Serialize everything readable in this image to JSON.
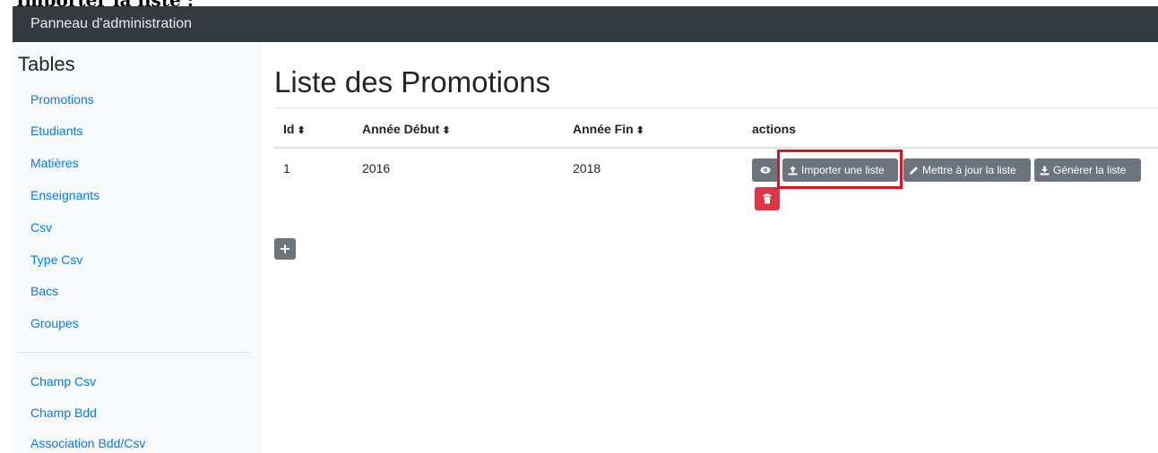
{
  "caption": "Importer la liste :",
  "navbar": {
    "brand": "Panneau d'administration"
  },
  "sidebar": {
    "heading": "Tables",
    "items": [
      {
        "label": "Promotions"
      },
      {
        "label": "Etudiants"
      },
      {
        "label": "Matières"
      },
      {
        "label": "Enseignants"
      },
      {
        "label": "Csv"
      },
      {
        "label": "Type Csv"
      },
      {
        "label": "Bacs"
      },
      {
        "label": "Groupes"
      }
    ],
    "items2": [
      {
        "label": "Champ Csv"
      },
      {
        "label": "Champ Bdd"
      },
      {
        "label": "Association Bdd/Csv"
      }
    ]
  },
  "main": {
    "title": "Liste des Promotions",
    "columns": [
      "Id",
      "Année Début",
      "Année Fin",
      "actions"
    ],
    "rows": [
      {
        "id": "1",
        "start": "2016",
        "end": "2018"
      }
    ],
    "actions": {
      "view_icon": "eye-icon",
      "import_label": "Importer une liste",
      "update_label": "Mettre à jour la liste",
      "generate_label": "Générer la liste",
      "delete_icon": "trash-icon"
    },
    "add_icon": "plus-icon"
  },
  "colors": {
    "navbar": "#343a40",
    "link": "#007bff",
    "secondary": "#6c757d",
    "danger": "#dc3545",
    "highlight": "#e8101c"
  }
}
